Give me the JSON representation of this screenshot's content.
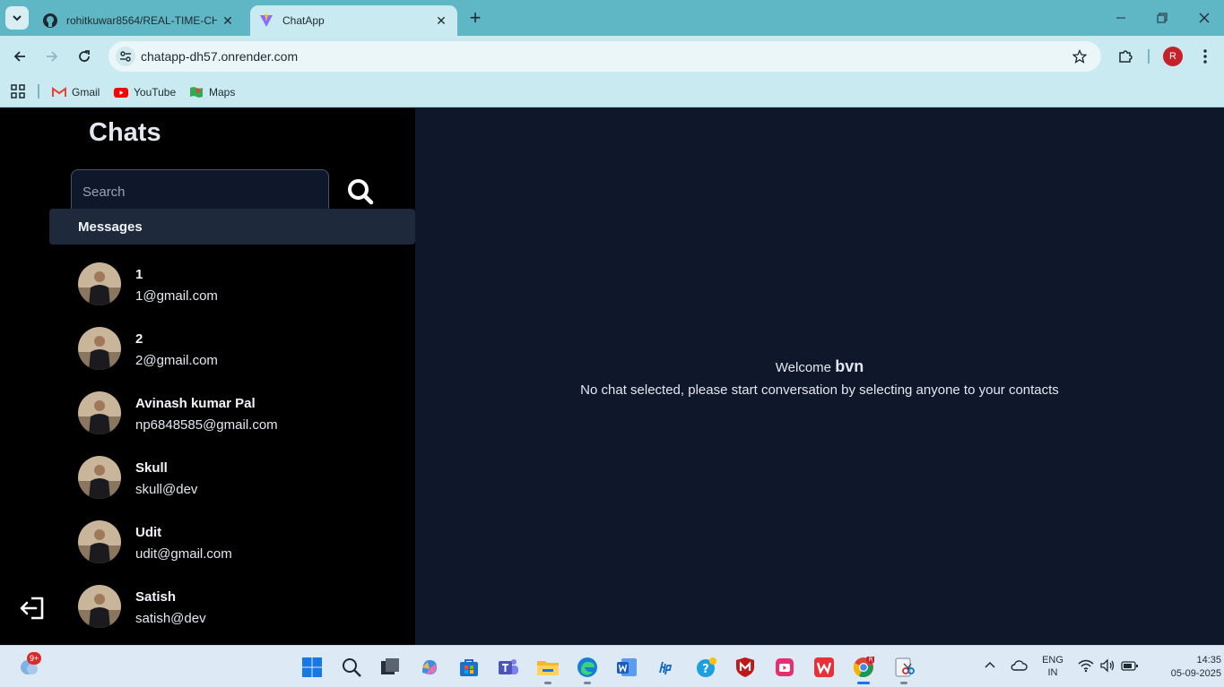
{
  "browser": {
    "tabs": [
      {
        "title": "rohitkuwar8564/REAL-TIME-CH",
        "icon": "github-icon"
      },
      {
        "title": "ChatApp",
        "icon": "vite-icon",
        "active": true
      }
    ],
    "url": "chatapp-dh57.onrender.com",
    "profile_initial": "R",
    "bookmarks": [
      {
        "label": "Gmail",
        "icon": "gmail-icon"
      },
      {
        "label": "YouTube",
        "icon": "youtube-icon"
      },
      {
        "label": "Maps",
        "icon": "maps-icon"
      }
    ]
  },
  "app": {
    "sidebar": {
      "title": "Chats",
      "search_placeholder": "Search",
      "section_label": "Messages",
      "contacts": [
        {
          "name": "1",
          "email": "1@gmail.com"
        },
        {
          "name": "2",
          "email": "2@gmail.com"
        },
        {
          "name": "Avinash kumar Pal",
          "email": "np6848585@gmail.com"
        },
        {
          "name": "Skull",
          "email": "skull@dev"
        },
        {
          "name": "Udit",
          "email": "udit@gmail.com"
        },
        {
          "name": "Satish",
          "email": "satish@dev"
        }
      ]
    },
    "main": {
      "welcome_prefix": "Welcome",
      "username": "bvn",
      "empty_message": "No chat selected, please start conversation by selecting anyone to your contacts"
    }
  },
  "taskbar": {
    "widget_badge": "9+",
    "apps": [
      "windows-start-icon",
      "search-icon",
      "task-view-icon",
      "copilot-icon",
      "store-icon",
      "teams-icon",
      "file-explorer-icon",
      "edge-icon",
      "word-icon",
      "hp-icon",
      "get-help-icon",
      "mcafee-icon",
      "clipchamp-icon",
      "wps-office-icon",
      "chrome-icon",
      "snipping-tool-icon"
    ],
    "language": "ENG",
    "region": "IN",
    "time": "14:35",
    "date": "05-09-2025"
  }
}
